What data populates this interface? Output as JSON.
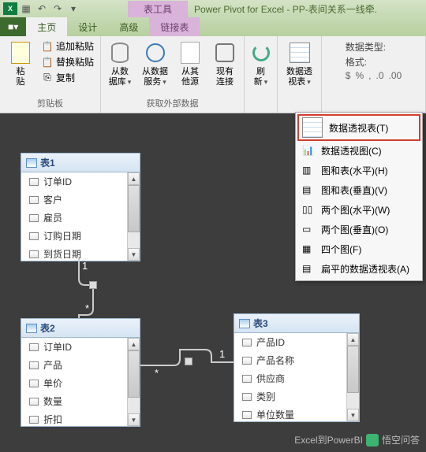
{
  "titlebar": {
    "contextual_tab": "表工具",
    "app_title": "Power Pivot for Excel - PP-表间关系一线牵."
  },
  "tabs": {
    "file": "■▾",
    "items": [
      "主页",
      "设计",
      "高级",
      "链接表"
    ],
    "active_index": 0
  },
  "ribbon": {
    "clipboard": {
      "label": "剪贴板",
      "paste": "粘\n贴",
      "append_paste": "追加粘贴",
      "replace_paste": "替换粘贴",
      "copy": "复制"
    },
    "external": {
      "label": "获取外部数据",
      "from_db": "从数\n据库",
      "from_service": "从数据\n服务",
      "from_other": "从其\n他源",
      "existing": "现有\n连接"
    },
    "refresh": "刷\n新",
    "pivot": "数据透\n视表",
    "format": {
      "datatype_label": "数据类型:",
      "format_label": "格式:",
      "symbols": [
        "$",
        "%",
        ",",
        ".0",
        ".00"
      ]
    }
  },
  "dropdown": {
    "items": [
      {
        "label": "数据透视表(T)",
        "icon": "pivot-table-icon"
      },
      {
        "label": "数据透视图(C)",
        "icon": "pivot-chart-icon"
      },
      {
        "label": "图和表(水平)(H)",
        "icon": "chart-table-h-icon"
      },
      {
        "label": "图和表(垂直)(V)",
        "icon": "chart-table-v-icon"
      },
      {
        "label": "两个图(水平)(W)",
        "icon": "two-charts-h-icon"
      },
      {
        "label": "两个图(垂直)(O)",
        "icon": "two-charts-v-icon"
      },
      {
        "label": "四个图(F)",
        "icon": "four-charts-icon"
      },
      {
        "label": "扁平的数据透视表(A)",
        "icon": "flat-pivot-icon"
      }
    ],
    "selected_index": 0
  },
  "tables": {
    "t1": {
      "name": "表1",
      "fields": [
        "订单ID",
        "客户",
        "雇员",
        "订购日期",
        "到货日期"
      ]
    },
    "t2": {
      "name": "表2",
      "fields": [
        "订单ID",
        "产品",
        "单价",
        "数量",
        "折扣"
      ]
    },
    "t3": {
      "name": "表3",
      "fields": [
        "产品ID",
        "产品名称",
        "供应商",
        "类别",
        "单位数量"
      ]
    }
  },
  "relations": {
    "one": "1",
    "many": "*"
  },
  "watermark": {
    "source": "Excel到PowerBI",
    "brand": "悟空问答"
  }
}
